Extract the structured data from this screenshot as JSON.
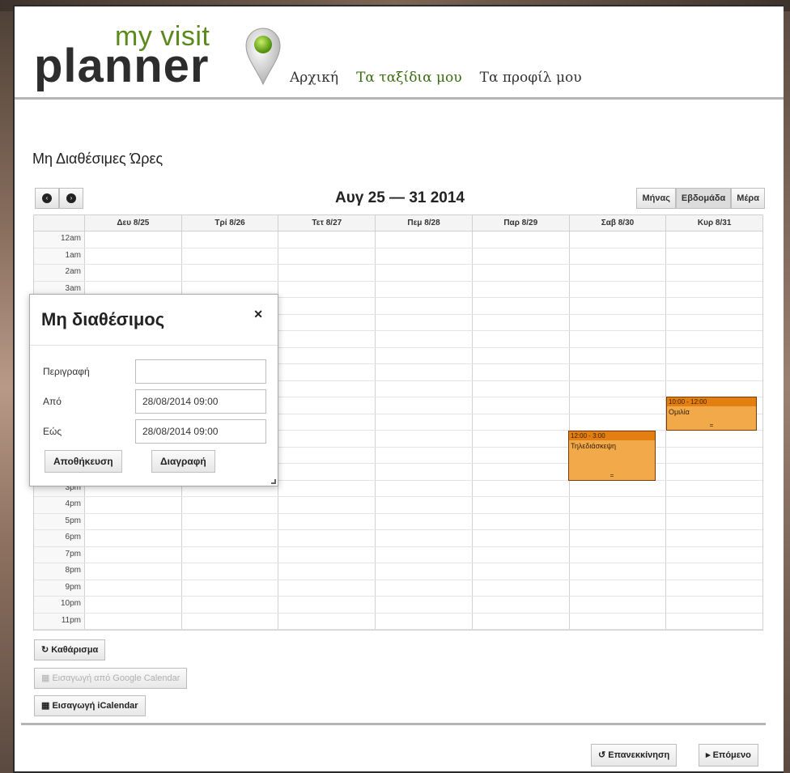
{
  "brand": {
    "small": "my visit",
    "big": "planner",
    "accent": "#5a8a1a",
    "pin_color": "#7fc41f"
  },
  "nav": [
    {
      "label": "Αρχική",
      "active": false
    },
    {
      "label": "Τα ταξίδια μου",
      "active": true
    },
    {
      "label": "Τα προφίλ μου",
      "active": false
    }
  ],
  "page": {
    "title": "Μη Διαθέσιμες Ώρες"
  },
  "calendar": {
    "prev_icon": "chevron-left-icon",
    "next_icon": "chevron-right-icon",
    "title": "Αυγ 25 — 31 2014",
    "views": [
      {
        "label": "Μήνας",
        "active": false
      },
      {
        "label": "Εβδομάδα",
        "active": true
      },
      {
        "label": "Μέρα",
        "active": false
      }
    ],
    "days": [
      "Δευ 8/25",
      "Τρί 8/26",
      "Τετ 8/27",
      "Πεμ 8/28",
      "Παρ 8/29",
      "Σαβ 8/30",
      "Κυρ 8/31"
    ],
    "hours": [
      "12am",
      "1am",
      "2am",
      "3am",
      "",
      "",
      "",
      "",
      "",
      "",
      "",
      "",
      "",
      "",
      "",
      "3pm",
      "4pm",
      "5pm",
      "6pm",
      "7pm",
      "8pm",
      "9pm",
      "10pm",
      "11pm"
    ],
    "events": [
      {
        "time": "10:00 - 12:00",
        "title": "Ομιλία",
        "day": "Κυρ 8/31",
        "color": "#f2a94a"
      },
      {
        "time": "12:00 - 3:00",
        "title": "Τηλεδιάσκεψη",
        "day": "Σαβ 8/30",
        "color": "#f2a94a"
      }
    ]
  },
  "dialog": {
    "title": "Μη διαθέσιμος",
    "close_icon": "close-icon",
    "description_label": "Περιγραφή",
    "description_value": "",
    "from_label": "Από",
    "from_value": "28/08/2014 09:00",
    "to_label": "Εώς",
    "to_value": "28/08/2014 09:00",
    "save_label": "Αποθήκευση",
    "delete_label": "Διαγραφή"
  },
  "actions": {
    "clear_label": "Καθάρισμα",
    "google_label": "Εισαγωγή από Google Calendar",
    "ical_label": "Εισαγωγή iCalendar"
  },
  "footer": {
    "restart_label": "Επανεκκίνηση",
    "next_label": "Επόμενο"
  }
}
